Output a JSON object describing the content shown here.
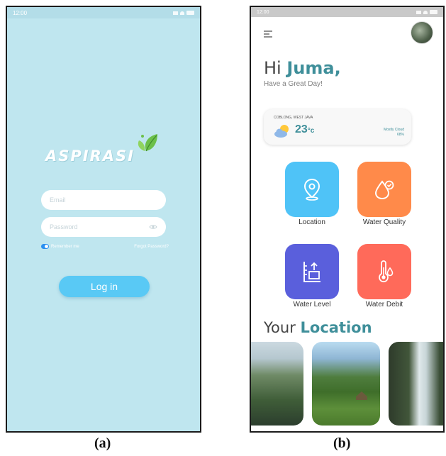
{
  "panel_a": {
    "status": {
      "time": "12:00"
    },
    "logo": {
      "text": "ASPIRASI",
      "icon": "leaf-logo-icon"
    },
    "email": {
      "placeholder": "Email",
      "value": ""
    },
    "password": {
      "placeholder": "Password",
      "value": ""
    },
    "remember_label": "Remember me",
    "forgot_label": "Forgot Password?",
    "login_label": "Log in"
  },
  "panel_b": {
    "status": {
      "time": "12:00"
    },
    "greeting": {
      "hi": "Hi ",
      "name": "Juma,",
      "subtitle": "Have a Great Day!"
    },
    "weather": {
      "location": "COBLONG, WEST JAVA",
      "temp": "23",
      "unit": "°c",
      "condition": "Mostly Cloud",
      "percent": "68%"
    },
    "tiles": [
      {
        "label": "Location",
        "icon": "location-pin-icon",
        "color": "#4fc3f7"
      },
      {
        "label": "Water Quality",
        "icon": "water-drop-check-icon",
        "color": "#ff8a4a"
      },
      {
        "label": "Water Level",
        "icon": "water-level-icon",
        "color": "#5a5fdc"
      },
      {
        "label": "Water Debit",
        "icon": "thermometer-drop-icon",
        "color": "#ff6a5a"
      }
    ],
    "section": {
      "prefix": "Your ",
      "highlight": "Location"
    }
  },
  "captions": {
    "a": "(a)",
    "b": "(b)"
  },
  "colors": {
    "accent": "#3f8f9a",
    "login_bg": "#bfe6ef",
    "button": "#59c9f5"
  }
}
